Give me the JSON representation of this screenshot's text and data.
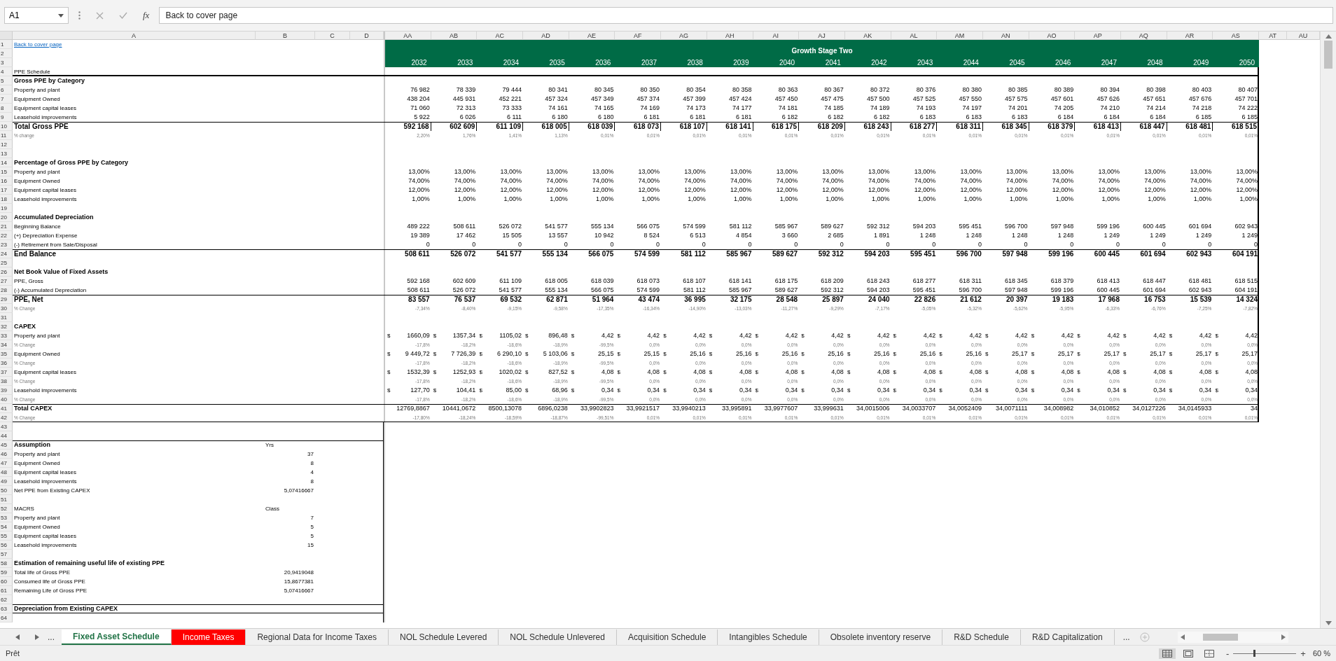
{
  "formula_bar": {
    "name_box": "A1",
    "fx_label": "fx",
    "formula": "Back to cover page"
  },
  "column_headers": [
    "A",
    "B",
    "C",
    "D",
    "AA",
    "AB",
    "AC",
    "AD",
    "AE",
    "AF",
    "AG",
    "AH",
    "AI",
    "AJ",
    "AK",
    "AL",
    "AM",
    "AN",
    "AO",
    "AP",
    "AQ",
    "AR",
    "AS",
    "AT",
    "AU"
  ],
  "band": {
    "title": "Growth Stage Two",
    "years": [
      "2032",
      "2033",
      "2034",
      "2035",
      "2036",
      "2037",
      "2038",
      "2039",
      "2040",
      "2041",
      "2042",
      "2043",
      "2044",
      "2045",
      "2046",
      "2047",
      "2048",
      "2049",
      "2050"
    ]
  },
  "rows": [
    {
      "n": "1",
      "kind": "link",
      "label": "Back to cover page"
    },
    {
      "n": "2"
    },
    {
      "n": "3"
    },
    {
      "n": "4",
      "kind": "caption",
      "label": "PPE Schedule"
    },
    {
      "n": "5",
      "kind": "section",
      "label": "Gross PPE by Category"
    },
    {
      "n": "6",
      "kind": "item",
      "label": "Property and plant",
      "values": [
        "76 982",
        "78 339",
        "79 444",
        "80 341",
        "80 345",
        "80 350",
        "80 354",
        "80 358",
        "80 363",
        "80 367",
        "80 372",
        "80 376",
        "80 380",
        "80 385",
        "80 389",
        "80 394",
        "80 398",
        "80 403",
        "80 407"
      ]
    },
    {
      "n": "7",
      "kind": "item",
      "label": "Equipment Owned",
      "values": [
        "438 204",
        "445 931",
        "452 221",
        "457 324",
        "457 349",
        "457 374",
        "457 399",
        "457 424",
        "457 450",
        "457 475",
        "457 500",
        "457 525",
        "457 550",
        "457 575",
        "457 601",
        "457 626",
        "457 651",
        "457 676",
        "457 701"
      ]
    },
    {
      "n": "8",
      "kind": "item",
      "label": "Equipment capital leases",
      "values": [
        "71 060",
        "72 313",
        "73 333",
        "74 161",
        "74 165",
        "74 169",
        "74 173",
        "74 177",
        "74 181",
        "74 185",
        "74 189",
        "74 193",
        "74 197",
        "74 201",
        "74 205",
        "74 210",
        "74 214",
        "74 218",
        "74 222"
      ]
    },
    {
      "n": "9",
      "kind": "item",
      "label": "Leasehold improvements",
      "values": [
        "5 922",
        "6 026",
        "6 111",
        "6 180",
        "6 180",
        "6 181",
        "6 181",
        "6 181",
        "6 182",
        "6 182",
        "6 182",
        "6 183",
        "6 183",
        "6 183",
        "6 184",
        "6 184",
        "6 184",
        "6 185",
        "6 185"
      ]
    },
    {
      "n": "10",
      "kind": "boxed_total",
      "label": "Total Gross PPE",
      "values": [
        "592 168",
        "602 609",
        "611 109",
        "618 005",
        "618 039",
        "618 073",
        "618 107",
        "618 141",
        "618 175",
        "618 209",
        "618 243",
        "618 277",
        "618 311",
        "618 345",
        "618 379",
        "618 413",
        "618 447",
        "618 481",
        "618 515"
      ]
    },
    {
      "n": "11",
      "kind": "change",
      "label": "% change",
      "values": [
        "2,20%",
        "1,76%",
        "1,41%",
        "1,13%",
        "0,01%",
        "0,01%",
        "0,01%",
        "0,01%",
        "0,01%",
        "0,01%",
        "0,01%",
        "0,01%",
        "0,01%",
        "0,01%",
        "0,01%",
        "0,01%",
        "0,01%",
        "0,01%",
        "0,01%"
      ]
    },
    {
      "n": "12"
    },
    {
      "n": "13"
    },
    {
      "n": "14",
      "kind": "section",
      "label": "Percentage of Gross PPE by Category"
    },
    {
      "n": "15",
      "kind": "item",
      "label": "Property and plant",
      "values": [
        "13,00%",
        "13,00%",
        "13,00%",
        "13,00%",
        "13,00%",
        "13,00%",
        "13,00%",
        "13,00%",
        "13,00%",
        "13,00%",
        "13,00%",
        "13,00%",
        "13,00%",
        "13,00%",
        "13,00%",
        "13,00%",
        "13,00%",
        "13,00%",
        "13,00%"
      ]
    },
    {
      "n": "16",
      "kind": "item",
      "label": "Equipment Owned",
      "values": [
        "74,00%",
        "74,00%",
        "74,00%",
        "74,00%",
        "74,00%",
        "74,00%",
        "74,00%",
        "74,00%",
        "74,00%",
        "74,00%",
        "74,00%",
        "74,00%",
        "74,00%",
        "74,00%",
        "74,00%",
        "74,00%",
        "74,00%",
        "74,00%",
        "74,00%"
      ]
    },
    {
      "n": "17",
      "kind": "item",
      "label": "Equipment capital leases",
      "values": [
        "12,00%",
        "12,00%",
        "12,00%",
        "12,00%",
        "12,00%",
        "12,00%",
        "12,00%",
        "12,00%",
        "12,00%",
        "12,00%",
        "12,00%",
        "12,00%",
        "12,00%",
        "12,00%",
        "12,00%",
        "12,00%",
        "12,00%",
        "12,00%",
        "12,00%"
      ]
    },
    {
      "n": "18",
      "kind": "item",
      "label": "Leasehold improvements",
      "values": [
        "1,00%",
        "1,00%",
        "1,00%",
        "1,00%",
        "1,00%",
        "1,00%",
        "1,00%",
        "1,00%",
        "1,00%",
        "1,00%",
        "1,00%",
        "1,00%",
        "1,00%",
        "1,00%",
        "1,00%",
        "1,00%",
        "1,00%",
        "1,00%",
        "1,00%"
      ]
    },
    {
      "n": "19"
    },
    {
      "n": "20",
      "kind": "section",
      "label": "Accumulated Depreciation"
    },
    {
      "n": "21",
      "kind": "item",
      "label": "Beginning Balance",
      "values": [
        "489 222",
        "508 611",
        "526 072",
        "541 577",
        "555 134",
        "566 075",
        "574 599",
        "581 112",
        "585 967",
        "589 627",
        "592 312",
        "594 203",
        "595 451",
        "596 700",
        "597 948",
        "599 196",
        "600 445",
        "601 694",
        "602 943"
      ]
    },
    {
      "n": "22",
      "kind": "item",
      "label": "(+) Depreciation Expense",
      "values": [
        "19 389",
        "17 462",
        "15 505",
        "13 557",
        "10 942",
        "8 524",
        "6 513",
        "4 854",
        "3 660",
        "2 685",
        "1 891",
        "1 248",
        "1 248",
        "1 248",
        "1 248",
        "1 249",
        "1 249",
        "1 249",
        "1 249"
      ]
    },
    {
      "n": "23",
      "kind": "item",
      "label": "(-) Retirement from Sale/Disposal",
      "values": [
        "0",
        "0",
        "0",
        "0",
        "0",
        "0",
        "0",
        "0",
        "0",
        "0",
        "0",
        "0",
        "0",
        "0",
        "0",
        "0",
        "0",
        "0",
        "0"
      ]
    },
    {
      "n": "24",
      "kind": "total",
      "label": "End Balance",
      "values": [
        "508 611",
        "526 072",
        "541 577",
        "555 134",
        "566 075",
        "574 599",
        "581 112",
        "585 967",
        "589 627",
        "592 312",
        "594 203",
        "595 451",
        "596 700",
        "597 948",
        "599 196",
        "600 445",
        "601 694",
        "602 943",
        "604 191"
      ]
    },
    {
      "n": "25"
    },
    {
      "n": "26",
      "kind": "section",
      "label": "Net Book Value of Fixed Assets"
    },
    {
      "n": "27",
      "kind": "item",
      "label": "PPE, Gross",
      "values": [
        "592 168",
        "602 609",
        "611 109",
        "618 005",
        "618 039",
        "618 073",
        "618 107",
        "618 141",
        "618 175",
        "618 209",
        "618 243",
        "618 277",
        "618 311",
        "618 345",
        "618 379",
        "618 413",
        "618 447",
        "618 481",
        "618 515"
      ]
    },
    {
      "n": "28",
      "kind": "item",
      "label": "(-) Accumulated Depreciation",
      "values": [
        "508 611",
        "526 072",
        "541 577",
        "555 134",
        "566 075",
        "574 599",
        "581 112",
        "585 967",
        "589 627",
        "592 312",
        "594 203",
        "595 451",
        "596 700",
        "597 948",
        "599 196",
        "600 445",
        "601 694",
        "602 943",
        "604 191"
      ]
    },
    {
      "n": "29",
      "kind": "total",
      "label": "PPE, Net",
      "values": [
        "83 557",
        "76 537",
        "69 532",
        "62 871",
        "51 964",
        "43 474",
        "36 995",
        "32 175",
        "28 548",
        "25 897",
        "24 040",
        "22 826",
        "21 612",
        "20 397",
        "19 183",
        "17 968",
        "16 753",
        "15 539",
        "14 324"
      ]
    },
    {
      "n": "30",
      "kind": "change",
      "label": "% Change",
      "values": [
        "-7,34%",
        "-8,40%",
        "-9,15%",
        "-9,58%",
        "-17,35%",
        "-16,34%",
        "-14,90%",
        "-13,03%",
        "-11,27%",
        "-9,29%",
        "-7,17%",
        "-5,05%",
        "-5,32%",
        "-5,62%",
        "-5,95%",
        "-6,33%",
        "-6,76%",
        "-7,25%",
        "-7,82%"
      ]
    },
    {
      "n": "31"
    },
    {
      "n": "32",
      "kind": "section",
      "label": "CAPEX"
    },
    {
      "n": "33",
      "kind": "capex",
      "label": "Property and plant",
      "values": [
        [
          "$",
          "1660,09"
        ],
        [
          "$",
          "1357,34"
        ],
        [
          "$",
          "1105,02"
        ],
        [
          "$",
          "896,48"
        ],
        [
          "$",
          "4,42"
        ],
        [
          "$",
          "4,42"
        ],
        [
          "$",
          "4,42"
        ],
        [
          "$",
          "4,42"
        ],
        [
          "$",
          "4,42"
        ],
        [
          "$",
          "4,42"
        ],
        [
          "$",
          "4,42"
        ],
        [
          "$",
          "4,42"
        ],
        [
          "$",
          "4,42"
        ],
        [
          "$",
          "4,42"
        ],
        [
          "$",
          "4,42"
        ],
        [
          "$",
          "4,42"
        ],
        [
          "$",
          "4,42"
        ],
        [
          "$",
          "4,42"
        ],
        [
          "$",
          "4,42"
        ]
      ]
    },
    {
      "n": "34",
      "kind": "change",
      "label": "% Change",
      "values": [
        "-17,8%",
        "-18,2%",
        "-18,6%",
        "-18,9%",
        "-99,5%",
        "0,0%",
        "0,0%",
        "0,0%",
        "0,0%",
        "0,0%",
        "0,0%",
        "0,0%",
        "0,0%",
        "0,0%",
        "0,0%",
        "0,0%",
        "0,0%",
        "0,0%",
        "0,0%"
      ]
    },
    {
      "n": "35",
      "kind": "capex",
      "label": "Equipment Owned",
      "values": [
        [
          "$",
          "9 449,72"
        ],
        [
          "$",
          "7 726,39"
        ],
        [
          "$",
          "6 290,10"
        ],
        [
          "$",
          "5 103,06"
        ],
        [
          "$",
          "25,15"
        ],
        [
          "$",
          "25,15"
        ],
        [
          "$",
          "25,16"
        ],
        [
          "$",
          "25,16"
        ],
        [
          "$",
          "25,16"
        ],
        [
          "$",
          "25,16"
        ],
        [
          "$",
          "25,16"
        ],
        [
          "$",
          "25,16"
        ],
        [
          "$",
          "25,16"
        ],
        [
          "$",
          "25,17"
        ],
        [
          "$",
          "25,17"
        ],
        [
          "$",
          "25,17"
        ],
        [
          "$",
          "25,17"
        ],
        [
          "$",
          "25,17"
        ],
        [
          "$",
          "25,17"
        ]
      ]
    },
    {
      "n": "36",
      "kind": "change",
      "label": "% Change",
      "values": [
        "-17,8%",
        "-18,2%",
        "-18,6%",
        "-18,9%",
        "-99,5%",
        "0,0%",
        "0,0%",
        "0,0%",
        "0,0%",
        "0,0%",
        "0,0%",
        "0,0%",
        "0,0%",
        "0,0%",
        "0,0%",
        "0,0%",
        "0,0%",
        "0,0%",
        "0,0%"
      ]
    },
    {
      "n": "37",
      "kind": "capex",
      "label": "Equipment capital leases",
      "values": [
        [
          "$",
          "1532,39"
        ],
        [
          "$",
          "1252,93"
        ],
        [
          "$",
          "1020,02"
        ],
        [
          "$",
          "827,52"
        ],
        [
          "$",
          "4,08"
        ],
        [
          "$",
          "4,08"
        ],
        [
          "$",
          "4,08"
        ],
        [
          "$",
          "4,08"
        ],
        [
          "$",
          "4,08"
        ],
        [
          "$",
          "4,08"
        ],
        [
          "$",
          "4,08"
        ],
        [
          "$",
          "4,08"
        ],
        [
          "$",
          "4,08"
        ],
        [
          "$",
          "4,08"
        ],
        [
          "$",
          "4,08"
        ],
        [
          "$",
          "4,08"
        ],
        [
          "$",
          "4,08"
        ],
        [
          "$",
          "4,08"
        ],
        [
          "$",
          "4,08"
        ]
      ]
    },
    {
      "n": "38",
      "kind": "change",
      "label": "% Change",
      "values": [
        "-17,8%",
        "-18,2%",
        "-18,6%",
        "-18,9%",
        "-99,5%",
        "0,0%",
        "0,0%",
        "0,0%",
        "0,0%",
        "0,0%",
        "0,0%",
        "0,0%",
        "0,0%",
        "0,0%",
        "0,0%",
        "0,0%",
        "0,0%",
        "0,0%",
        "0,0%"
      ]
    },
    {
      "n": "39",
      "kind": "capex",
      "label": "Leasehold improvements",
      "values": [
        [
          "$",
          "127,70"
        ],
        [
          "$",
          "104,41"
        ],
        [
          "$",
          "85,00"
        ],
        [
          "$",
          "68,96"
        ],
        [
          "$",
          "0,34"
        ],
        [
          "$",
          "0,34"
        ],
        [
          "$",
          "0,34"
        ],
        [
          "$",
          "0,34"
        ],
        [
          "$",
          "0,34"
        ],
        [
          "$",
          "0,34"
        ],
        [
          "$",
          "0,34"
        ],
        [
          "$",
          "0,34"
        ],
        [
          "$",
          "0,34"
        ],
        [
          "$",
          "0,34"
        ],
        [
          "$",
          "0,34"
        ],
        [
          "$",
          "0,34"
        ],
        [
          "$",
          "0,34"
        ],
        [
          "$",
          "0,34"
        ],
        [
          "$",
          "0,34"
        ]
      ]
    },
    {
      "n": "40",
      "kind": "change",
      "label": "% Change",
      "values": [
        "-17,8%",
        "-18,2%",
        "-18,6%",
        "-18,9%",
        "-99,5%",
        "0,0%",
        "0,0%",
        "0,0%",
        "0,0%",
        "0,0%",
        "0,0%",
        "0,0%",
        "0,0%",
        "0,0%",
        "0,0%",
        "0,0%",
        "0,0%",
        "0,0%",
        "0,0%"
      ]
    },
    {
      "n": "41",
      "kind": "sum",
      "label": "Total CAPEX",
      "values": [
        "12769,8867",
        "10441,0672",
        "8500,13078",
        "6896,0238",
        "33,9902823",
        "33,9921517",
        "33,9940213",
        "33,995891",
        "33,9977607",
        "33,999631",
        "34,0015006",
        "34,0033707",
        "34,0052409",
        "34,0071111",
        "34,008982",
        "34,010852",
        "34,0127226",
        "34,0145933",
        "34"
      ]
    },
    {
      "n": "42",
      "kind": "change",
      "label": "% Change",
      "values": [
        "-17,80%",
        "-18,24%",
        "-18,59%",
        "-18,87%",
        "-99,51%",
        "0,01%",
        "0,01%",
        "0,01%",
        "0,01%",
        "0,01%",
        "0,01%",
        "0,01%",
        "0,01%",
        "0,01%",
        "0,01%",
        "0,01%",
        "0,01%",
        "0,01%",
        "0,01%"
      ]
    },
    {
      "n": "43"
    },
    {
      "n": "44"
    },
    {
      "n": "45",
      "kind": "section",
      "label": "Assumption",
      "b": "Yrs"
    },
    {
      "n": "46",
      "kind": "item",
      "label": "Property and plant",
      "b": "37"
    },
    {
      "n": "47",
      "kind": "item",
      "label": "Equipment Owned",
      "b": "8"
    },
    {
      "n": "48",
      "kind": "item",
      "label": "Equipment capital leases",
      "b": "4"
    },
    {
      "n": "49",
      "kind": "item",
      "label": "Leasehold improvements",
      "b": "8"
    },
    {
      "n": "50",
      "kind": "item",
      "label": "Net PPE from Existing CAPEX",
      "b": "5,07416667"
    },
    {
      "n": "51"
    },
    {
      "n": "52",
      "kind": "item",
      "label": "MACRS",
      "b": "Class"
    },
    {
      "n": "53",
      "kind": "item",
      "label": "Property and plant",
      "b": "7"
    },
    {
      "n": "54",
      "kind": "item",
      "label": "Equipment Owned",
      "b": "5"
    },
    {
      "n": "55",
      "kind": "item",
      "label": "Equipment capital leases",
      "b": "5"
    },
    {
      "n": "56",
      "kind": "item",
      "label": "Leasehold improvements",
      "b": "15"
    },
    {
      "n": "57"
    },
    {
      "n": "58",
      "kind": "section",
      "label": "Estimation of remaining useful life of existing PPE"
    },
    {
      "n": "59",
      "kind": "item",
      "label": "Total life of Gross PPE",
      "b": "20,9419048"
    },
    {
      "n": "60",
      "kind": "item",
      "label": "Consumed life of Gross PPE",
      "b": "15,8677381"
    },
    {
      "n": "61",
      "kind": "item",
      "label": "Remaining Life of Gross PPE",
      "b": "5,07416667"
    },
    {
      "n": "62"
    },
    {
      "n": "63",
      "kind": "section",
      "label": "Depreciation from Existing CAPEX"
    },
    {
      "n": "64"
    }
  ],
  "sheet_nav": {
    "more_left": "...",
    "more_right": "..."
  },
  "tabs": [
    {
      "label": "Fixed Asset Schedule",
      "selected": true
    },
    {
      "label": "Income Taxes",
      "selected": false,
      "color": "#ff0000"
    },
    {
      "label": "Regional Data for Income Taxes",
      "selected": false
    },
    {
      "label": "NOL Schedule Levered",
      "selected": false
    },
    {
      "label": "NOL Schedule Unlevered",
      "selected": false
    },
    {
      "label": "Acquisition Schedule",
      "selected": false
    },
    {
      "label": "Intangibles Schedule",
      "selected": false
    },
    {
      "label": "Obsolete inventory reserve",
      "selected": false
    },
    {
      "label": "R&D Schedule",
      "selected": false
    },
    {
      "label": "R&D Capitalization",
      "selected": false
    }
  ],
  "status_bar": {
    "status": "Prêt",
    "views": [
      {
        "kind": "normal",
        "selected": true
      },
      {
        "kind": "page_layout",
        "selected": false
      },
      {
        "kind": "page_break",
        "selected": false
      }
    ],
    "zoom_minus": "-",
    "zoom_plus": "+",
    "zoom_slider": {
      "level": 0.33
    },
    "zoom": "60 %"
  }
}
